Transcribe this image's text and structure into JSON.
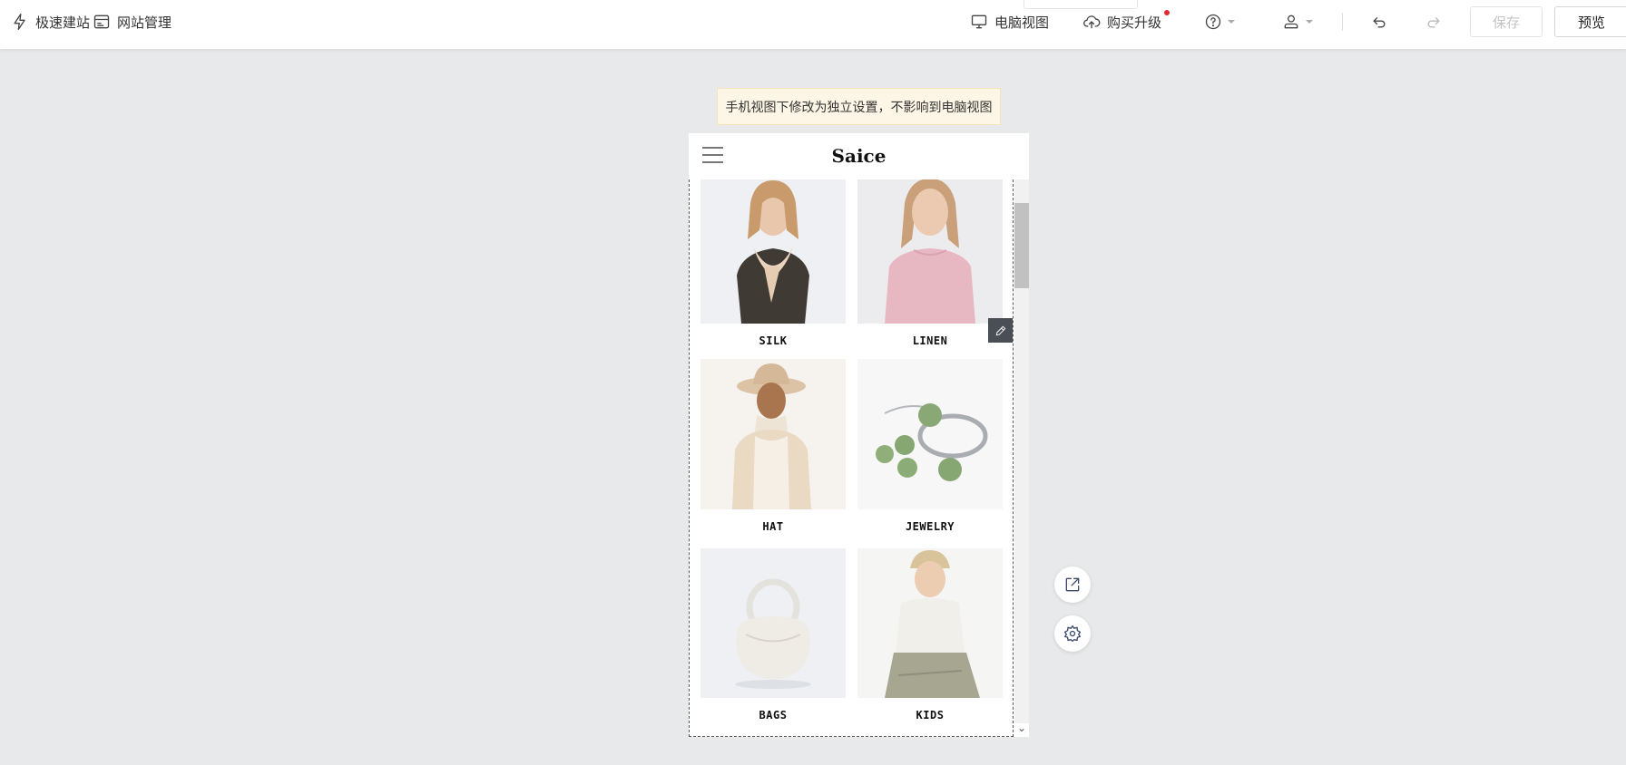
{
  "toolbar": {
    "quick_build": "极速建站",
    "site_manage": "网站管理",
    "pc_view": "电脑视图",
    "upgrade": "购买升级",
    "save": "保存",
    "preview": "预览"
  },
  "notice": "手机视图下修改为独立设置，不影响到电脑视图",
  "phone": {
    "brand": "Saice",
    "categories": [
      {
        "label": "SILK",
        "icon": "woman-scarf-image"
      },
      {
        "label": "LINEN",
        "icon": "woman-pink-sweater-image"
      },
      {
        "label": "HAT",
        "icon": "woman-hat-image"
      },
      {
        "label": "JEWELRY",
        "icon": "jade-bracelet-image"
      },
      {
        "label": "BAGS",
        "icon": "white-handbag-image"
      },
      {
        "label": "KIDS",
        "icon": "boy-image"
      }
    ]
  },
  "colors": {
    "canvas": "#e8e9eb",
    "notice_bg": "#fdf6e6",
    "fab_icon": "#3b4a6a",
    "red_dot": "#e5282d"
  }
}
